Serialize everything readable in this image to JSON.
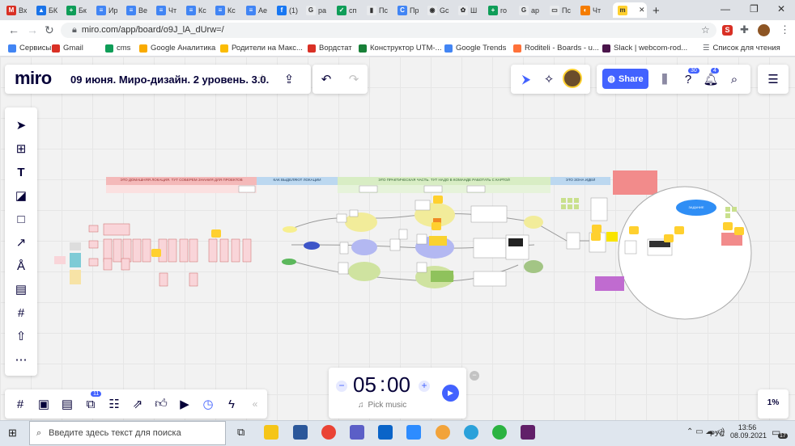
{
  "browser": {
    "tabs": [
      {
        "label": "Вх",
        "color": "#d93025",
        "glyph": "M"
      },
      {
        "label": "БК",
        "color": "#1a73e8",
        "glyph": "▲"
      },
      {
        "label": "Бк",
        "color": "#0f9d58",
        "glyph": "+"
      },
      {
        "label": "Ир",
        "color": "#4285f4",
        "glyph": "≡"
      },
      {
        "label": "Ве",
        "color": "#4285f4",
        "glyph": "≡"
      },
      {
        "label": "Чт",
        "color": "#4285f4",
        "glyph": "≡"
      },
      {
        "label": "Кс",
        "color": "#4285f4",
        "glyph": "≡"
      },
      {
        "label": "Кс",
        "color": "#4285f4",
        "glyph": "≡"
      },
      {
        "label": "Ае",
        "color": "#4285f4",
        "glyph": "≡"
      },
      {
        "label": "(1)",
        "color": "#1877f2",
        "glyph": "f"
      },
      {
        "label": "ра",
        "color": "#e8eaed",
        "glyph": "G"
      },
      {
        "label": "сп",
        "color": "#0f9d58",
        "glyph": "✓"
      },
      {
        "label": "Пс",
        "color": "#e8eaed",
        "glyph": "▮"
      },
      {
        "label": "Пр",
        "color": "#4285f4",
        "glyph": "C"
      },
      {
        "label": "Gc",
        "color": "#e8eaed",
        "glyph": "◉"
      },
      {
        "label": "Ш",
        "color": "#e8eaed",
        "glyph": "✿"
      },
      {
        "label": "ro",
        "color": "#0f9d58",
        "glyph": "+"
      },
      {
        "label": "ар",
        "color": "#e8eaed",
        "glyph": "G"
      },
      {
        "label": "Пс",
        "color": "#e8eaed",
        "glyph": "▭"
      },
      {
        "label": "Чт",
        "color": "#f57c00",
        "glyph": "◐"
      },
      {
        "label": "",
        "color": "#ffd02f",
        "glyph": "m"
      }
    ],
    "new_tab": "+",
    "url": "miro.com/app/board/o9J_lA_dUrw=/",
    "bookmarks": [
      {
        "label": "Сервисы",
        "color": "#4285f4"
      },
      {
        "label": "Gmail",
        "color": "#d93025"
      },
      {
        "label": "cms",
        "color": "#0f9d58"
      },
      {
        "label": "Google Аналитика",
        "color": "#f9ab00"
      },
      {
        "label": "Родители на Макс...",
        "color": "#fbbc04"
      },
      {
        "label": "Вордстат",
        "color": "#d93025"
      },
      {
        "label": "Конструктор UTM-...",
        "color": "#188038"
      },
      {
        "label": "Google Trends",
        "color": "#4285f4"
      },
      {
        "label": "Roditeli - Boards - u...",
        "color": "#ff7139"
      },
      {
        "label": "Slack | webcom-rod...",
        "color": "#4a154b"
      }
    ],
    "reading_list": "Список для чтения"
  },
  "miro": {
    "logo": "miro",
    "board_title": "09 июня. Миро-дизайн. 2 уровень. 3.0.",
    "share_label": "Share",
    "help_badge": "30",
    "notif_badge": "4",
    "apps_badge": "11",
    "zoom": "1%",
    "timer": {
      "minutes": "05",
      "colon": ":",
      "seconds": "00",
      "music": "Pick music",
      "minus": "−",
      "plus": "+"
    },
    "board_text": {
      "header1": "ЭТО ДОМАШНЯЯ ЛОКАЦИЯ. ТУТ СОБЕРЕМ ЗНАНИЯ ДЛЯ ПРОЕКТОВ",
      "header2": "КАК ВЫДЕЛЯЮТ ЛОКАЦИИ",
      "header3": "ЭТО ПРАКТИЧЕСКАЯ ЧАСТЬ. ТУТ НАДО В КОМАНДЕ РАБОТАТЬ С КАРТОЙ",
      "header4": "ЭТО ЗОНА ИДЕЙ",
      "ellipse_label": "ЗАДАНИЕ"
    }
  },
  "taskbar": {
    "search_placeholder": "Введите здесь текст для поиска",
    "lang": "РУС",
    "time": "13:56",
    "date": "08.09.2021",
    "notif_count": "17"
  }
}
